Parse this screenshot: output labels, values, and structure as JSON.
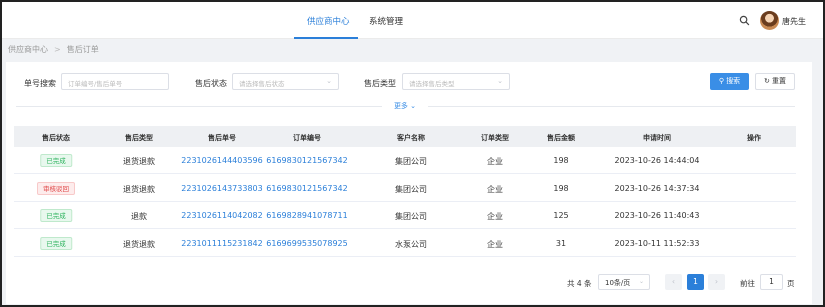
{
  "nav": {
    "tabs": [
      {
        "label": "供应商中心",
        "active": true
      },
      {
        "label": "系统管理",
        "active": false
      }
    ],
    "user": "唐先生"
  },
  "breadcrumb": [
    "供应商中心",
    "售后订单"
  ],
  "filters": {
    "order_no_label": "单号搜索",
    "order_no_placeholder": "订单编号/售后单号",
    "status_label": "售后状态",
    "status_placeholder": "请选择售后状态",
    "type_label": "售后类型",
    "type_placeholder": "请选择售后类型",
    "search_button": "搜索",
    "reset_button": "重置",
    "more": "更多"
  },
  "table": {
    "headers": [
      "售后状态",
      "售后类型",
      "售后单号",
      "订单编号",
      "客户名称",
      "订单类型",
      "售后金额",
      "申请时间",
      "操作"
    ],
    "rows": [
      {
        "status": "已完成",
        "status_type": "ok",
        "type": "退货退款",
        "aftersale_no": "2231026144403596",
        "order_no": "6169830121567342",
        "customer": "集团公司",
        "order_type": "企业",
        "amount": "198",
        "time": "2023-10-26 14:44:04",
        "action": ""
      },
      {
        "status": "审核驳回",
        "status_type": "bad",
        "type": "退货退款",
        "aftersale_no": "2231026143733803",
        "order_no": "6169830121567342",
        "customer": "集团公司",
        "order_type": "企业",
        "amount": "198",
        "time": "2023-10-26 14:37:34",
        "action": ""
      },
      {
        "status": "已完成",
        "status_type": "ok",
        "type": "退款",
        "aftersale_no": "2231026114042082",
        "order_no": "6169828941078711",
        "customer": "集团公司",
        "order_type": "企业",
        "amount": "125",
        "time": "2023-10-26 11:40:43",
        "action": ""
      },
      {
        "status": "已完成",
        "status_type": "ok",
        "type": "退货退款",
        "aftersale_no": "2231011115231842",
        "order_no": "6169699535078925",
        "customer": "水泵公司",
        "order_type": "企业",
        "amount": "31",
        "time": "2023-10-11 11:52:33",
        "action": ""
      }
    ]
  },
  "pagination": {
    "total": "共 4 条",
    "page_size": "10条/页",
    "current_page": "1",
    "goto_label": "前往",
    "goto_value": "1",
    "page_suffix": "页"
  },
  "colors": {
    "accent": "#2b7fd9",
    "success": "#2fb35f",
    "danger": "#e04848"
  }
}
